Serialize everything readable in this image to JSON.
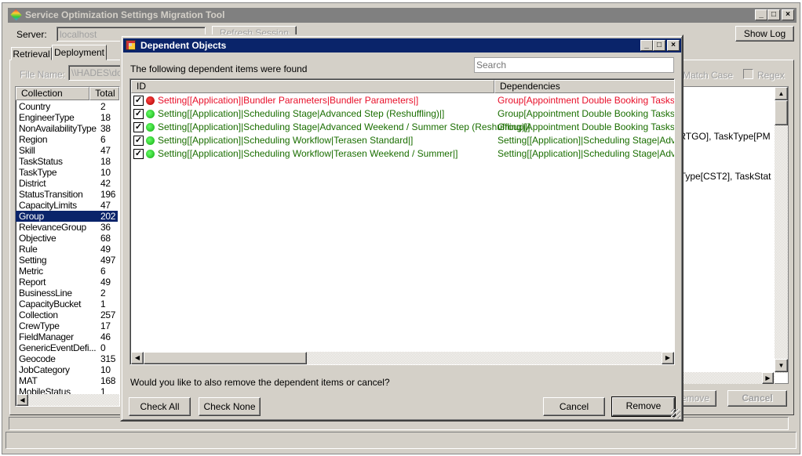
{
  "main": {
    "title": "Service Optimization Settings Migration Tool",
    "server_label": "Server:",
    "server_value": "localhost",
    "refresh_label": "Refresh Session",
    "show_log_label": "Show Log",
    "tabs": [
      {
        "label": "Retrieval"
      },
      {
        "label": "Deployment"
      }
    ],
    "file_name_label": "File Name:",
    "file_name_value": "\\\\HADES\\dc",
    "match_case_label": "Match Case",
    "regex_label": "Regex",
    "columns": [
      "Collection",
      "Total"
    ],
    "collections": [
      [
        "Country",
        "2"
      ],
      [
        "EngineerType",
        "18"
      ],
      [
        "NonAvailabilityType",
        "38"
      ],
      [
        "Region",
        "6"
      ],
      [
        "Skill",
        "47"
      ],
      [
        "TaskStatus",
        "18"
      ],
      [
        "TaskType",
        "10"
      ],
      [
        "District",
        "42"
      ],
      [
        "StatusTransition",
        "196"
      ],
      [
        "CapacityLimits",
        "47"
      ],
      [
        "Group",
        "202"
      ],
      [
        "RelevanceGroup",
        "36"
      ],
      [
        "Objective",
        "68"
      ],
      [
        "Rule",
        "49"
      ],
      [
        "Setting",
        "497"
      ],
      [
        "Metric",
        "6"
      ],
      [
        "Report",
        "49"
      ],
      [
        "BusinessLine",
        "2"
      ],
      [
        "CapacityBucket",
        "1"
      ],
      [
        "Collection",
        "257"
      ],
      [
        "CrewType",
        "17"
      ],
      [
        "FieldManager",
        "46"
      ],
      [
        "GenericEventDefi...",
        "0"
      ],
      [
        "Geocode",
        "315"
      ],
      [
        "JobCategory",
        "10"
      ],
      [
        "MAT",
        "168"
      ],
      [
        "MobileStatus",
        "1"
      ]
    ],
    "selected_collection": "Group",
    "detail_text_1": "s[RTGO], TaskType[PM",
    "detail_text_2": "erType[CST2], TaskStat",
    "remove_label": "Remove",
    "cancel_label": "Cancel"
  },
  "dialog": {
    "title": "Dependent Objects",
    "intro": "The following dependent items were found",
    "search_placeholder": "Search",
    "columns": {
      "id": "ID",
      "deps": "Dependencies"
    },
    "items": [
      {
        "id": "Setting[[Application]|Bundler Parameters|Bundler Parameters|]",
        "deps": "Group[Appointment Double Booking Tasks], Gro",
        "status": "error",
        "checked": true
      },
      {
        "id": "Setting[[Application]|Scheduling Stage|Advanced Step (Reshuffling)|]",
        "deps": "Group[Appointment Double Booking Tasks], Gro",
        "status": "ok",
        "checked": true
      },
      {
        "id": "Setting[[Application]|Scheduling Stage|Advanced Weekend / Summer Step (Reshuffling)|]",
        "deps": "Group[Appointment Double Booking Tasks], Gro",
        "status": "ok",
        "checked": true
      },
      {
        "id": "Setting[[Application]|Scheduling Workflow|Terasen Standard|]",
        "deps": "Setting[[Application]|Scheduling Stage|Advance",
        "status": "ok",
        "checked": true
      },
      {
        "id": "Setting[[Application]|Scheduling Workflow|Terasen Weekend / Summer|]",
        "deps": "Setting[[Application]|Scheduling Stage|Advance",
        "status": "ok",
        "checked": true
      }
    ],
    "question": "Would you like to also remove the dependent items or cancel?",
    "check_all_label": "Check All",
    "check_none_label": "Check None",
    "cancel_label": "Cancel",
    "remove_label": "Remove",
    "colors": {
      "error": "#e8102a",
      "ok": "#1a6e00"
    }
  }
}
